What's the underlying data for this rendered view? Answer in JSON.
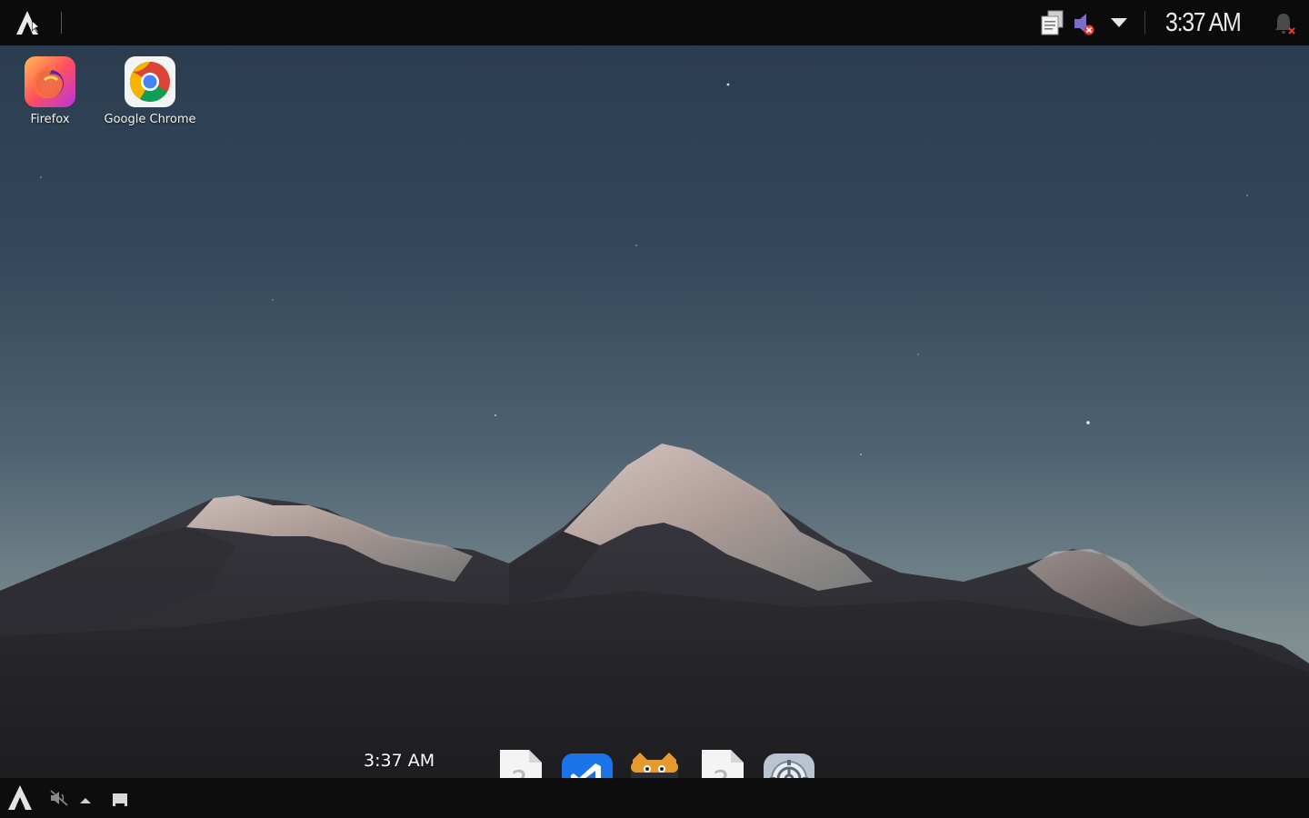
{
  "top_panel": {
    "clock": "3:37 AM",
    "launcher_icon": "arch-logo-icon",
    "tray": [
      {
        "icon": "clipboard-icon"
      },
      {
        "icon": "volume-muted-icon"
      },
      {
        "icon": "chevron-down-icon"
      },
      {
        "icon": "notification-bell-icon"
      }
    ]
  },
  "desktop": {
    "icons": [
      {
        "label": "Firefox",
        "icon": "firefox-icon"
      },
      {
        "label": "Google Chrome",
        "icon": "chrome-icon"
      }
    ]
  },
  "dock": {
    "clock": "3:37 AM",
    "items": [
      {
        "icon": "unknown-file-icon"
      },
      {
        "icon": "vscode-icon"
      },
      {
        "icon": "terminal-cat-icon"
      },
      {
        "icon": "unknown-file-icon"
      },
      {
        "icon": "settings-gear-icon"
      }
    ]
  },
  "bottom_panel": {
    "items": [
      {
        "icon": "arch-logo-icon"
      },
      {
        "icon": "volume-muted-icon"
      },
      {
        "icon": "chevron-up-icon"
      },
      {
        "icon": "show-desktop-icon"
      }
    ]
  },
  "colors": {
    "panel_bg": "#0b0b0c",
    "clock_text": "#e9e9e9",
    "vscode_blue": "#1a73e8",
    "mute_x_red": "#e53935"
  }
}
